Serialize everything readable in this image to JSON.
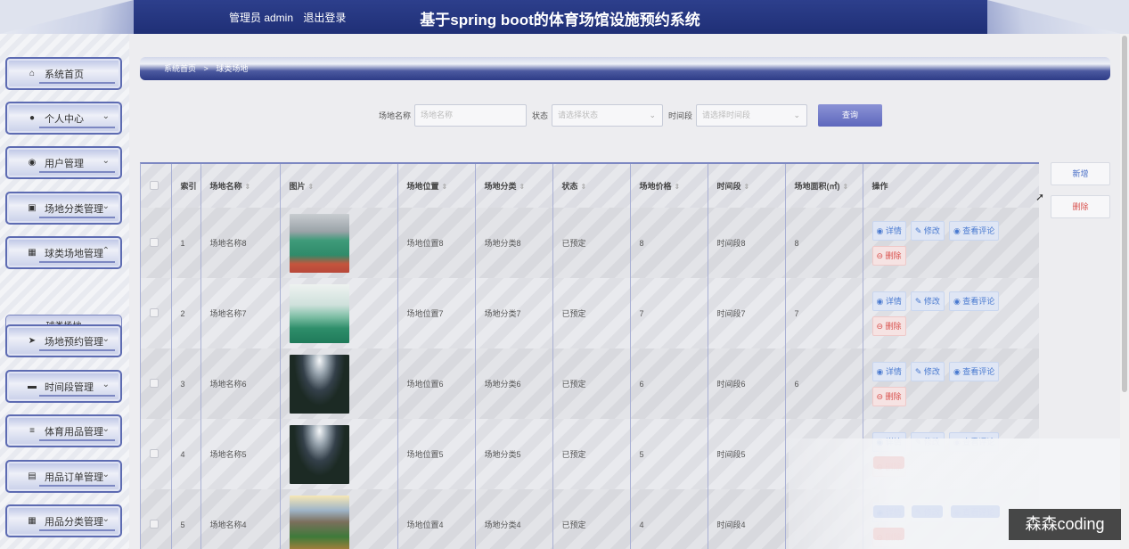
{
  "header": {
    "user_prefix": "管理员 admin",
    "logout": "退出登录",
    "title": "基于spring boot的体育场馆设施预约系统"
  },
  "sidebar": {
    "items": [
      {
        "label": "系统首页",
        "icon": "home-icon",
        "glyph": "⌂"
      },
      {
        "label": "个人中心",
        "icon": "user-icon",
        "glyph": "●"
      },
      {
        "label": "用户管理",
        "icon": "location-icon",
        "glyph": "◉"
      },
      {
        "label": "场地分类管理",
        "icon": "box-icon",
        "glyph": "▣"
      },
      {
        "label": "球类场地管理",
        "icon": "grid-icon",
        "glyph": "▦"
      },
      {
        "label": "场地预约管理",
        "icon": "send-icon",
        "glyph": "➤"
      },
      {
        "label": "时间段管理",
        "icon": "briefcase-icon",
        "glyph": "▬"
      },
      {
        "label": "体育用品管理",
        "icon": "list-icon",
        "glyph": "≡"
      },
      {
        "label": "用品订单管理",
        "icon": "document-icon",
        "glyph": "▤"
      },
      {
        "label": "用品分类管理",
        "icon": "grid-icon",
        "glyph": "▦"
      }
    ],
    "sub_item": "球类场地"
  },
  "breadcrumb": {
    "home": "系统首页",
    "sep": ">",
    "current": "球类场地"
  },
  "search": {
    "name_label": "场地名称",
    "name_placeholder": "场地名称",
    "status_label": "状态",
    "status_placeholder": "请选择状态",
    "time_label": "时间段",
    "time_placeholder": "请选择时间段",
    "query_button": "查询"
  },
  "actions": {
    "add": "新增",
    "delete": "删除"
  },
  "table": {
    "columns": [
      "索引",
      "场地名称",
      "图片",
      "场地位置",
      "场地分类",
      "状态",
      "场地价格",
      "时间段",
      "场地面积(㎡)",
      "操作"
    ],
    "ops": {
      "detail": "详情",
      "edit": "修改",
      "comments": "查看评论",
      "delete": "删除"
    },
    "rows": [
      {
        "index": "1",
        "name": "场地名称8",
        "location": "场地位置8",
        "category": "场地分类8",
        "status": "已预定",
        "price": "8",
        "time": "时间段8",
        "area": "8",
        "image": "basketball-court"
      },
      {
        "index": "2",
        "name": "场地名称7",
        "location": "场地位置7",
        "category": "场地分类7",
        "status": "已预定",
        "price": "7",
        "time": "时间段7",
        "area": "7",
        "image": "indoor-court"
      },
      {
        "index": "3",
        "name": "场地名称6",
        "location": "场地位置6",
        "category": "场地分类6",
        "status": "已预定",
        "price": "6",
        "time": "时间段6",
        "area": "6",
        "image": "stadium-lights"
      },
      {
        "index": "4",
        "name": "场地名称5",
        "location": "场地位置5",
        "category": "场地分类5",
        "status": "已预定",
        "price": "5",
        "time": "时间段5",
        "area": "",
        "image": "stadium-lights"
      },
      {
        "index": "5",
        "name": "场地名称4",
        "location": "场地位置4",
        "category": "场地分类4",
        "status": "已预定",
        "price": "4",
        "time": "时间段4",
        "area": "",
        "image": "baseball-stadium"
      }
    ]
  },
  "watermark": "森森coding"
}
